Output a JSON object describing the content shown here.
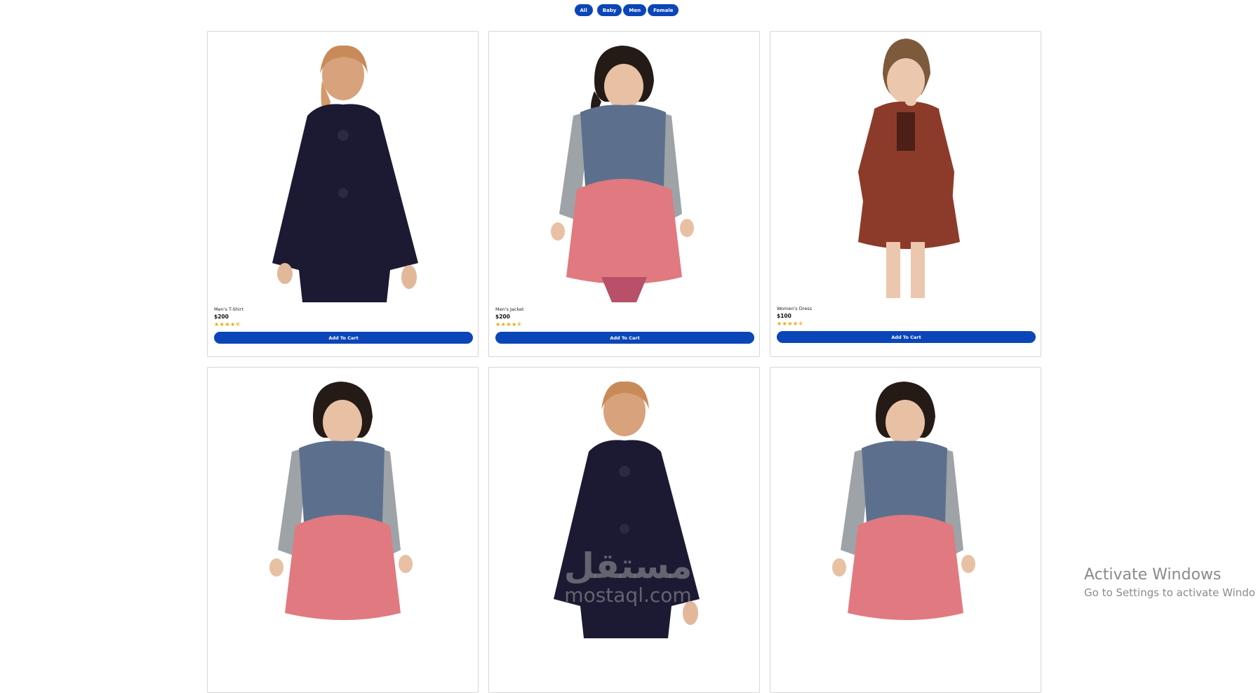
{
  "filters": [
    "All",
    "Baby",
    "Men",
    "Female"
  ],
  "products": [
    {
      "name": "Men's T-Shirt",
      "price": "$200",
      "rating": "★★★★⯪",
      "button": "Add To Cart",
      "figure": "coat-blonde"
    },
    {
      "name": "Men's Jacket",
      "price": "$200",
      "rating": "★★★★⯪",
      "button": "Add To Cart",
      "figure": "vest-dark"
    },
    {
      "name": "Women's Dress",
      "price": "$100",
      "rating": "★★★★⯪",
      "button": "Add To Cart",
      "figure": "dress-rust"
    },
    {
      "name": "",
      "price": "",
      "rating": "",
      "button": "",
      "figure": "vest-dark"
    },
    {
      "name": "",
      "price": "",
      "rating": "",
      "button": "",
      "figure": "coat-blonde"
    },
    {
      "name": "",
      "price": "",
      "rating": "",
      "button": "",
      "figure": "vest-dark"
    }
  ],
  "watermark": {
    "arabic": "مستقل",
    "latin": "mostaql.com"
  },
  "os_notice": {
    "title": "Activate Windows",
    "subtitle": "Go to Settings to activate Windows."
  },
  "colors": {
    "accent": "#0b46b8",
    "star": "#f2a100"
  }
}
